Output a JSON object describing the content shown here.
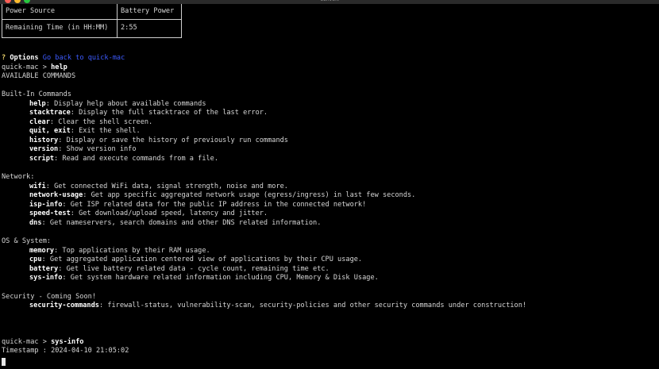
{
  "window": {
    "title": "convert"
  },
  "table": [
    {
      "key": "Power Source",
      "value": "Battery Power"
    },
    {
      "key": "Remaining Time (in HH:MM)",
      "value": "2:55"
    }
  ],
  "options": {
    "marker": "?",
    "label": "Options",
    "link": "Go back to quick-mac"
  },
  "prompt": "quick-mac > ",
  "first_command": "help",
  "available_heading": "AVAILABLE COMMANDS",
  "sections": [
    {
      "title": "Built-In Commands",
      "items": [
        {
          "name": "help",
          "desc": "Display help about available commands"
        },
        {
          "name": "stacktrace",
          "desc": "Display the full stacktrace of the last error."
        },
        {
          "name": "clear",
          "desc": "Clear the shell screen."
        },
        {
          "name": "quit, exit",
          "desc": "Exit the shell."
        },
        {
          "name": "history",
          "desc": "Display or save the history of previously run commands"
        },
        {
          "name": "version",
          "desc": "Show version info"
        },
        {
          "name": "script",
          "desc": "Read and execute commands from a file."
        }
      ]
    },
    {
      "title": "Network:",
      "items": [
        {
          "name": "wifi",
          "desc": "Get connected WiFi data, signal strength, noise and more."
        },
        {
          "name": "network-usage",
          "desc": "Get app specific aggregated network usage (egress/ingress) in last few seconds."
        },
        {
          "name": "isp-info",
          "desc": "Get ISP related data for the public IP address in the connected network!"
        },
        {
          "name": "speed-test",
          "desc": "Get download/upload speed, latency and jitter."
        },
        {
          "name": "dns",
          "desc": "Get nameservers, search domains and other DNS related information."
        }
      ]
    },
    {
      "title": "OS & System:",
      "items": [
        {
          "name": "memory",
          "desc": "Top applications by their RAM usage."
        },
        {
          "name": "cpu",
          "desc": "Get aggregated application centered view of applications by their CPU usage."
        },
        {
          "name": "battery",
          "desc": "Get live battery related data - cycle count, remaining time etc."
        },
        {
          "name": "sys-info",
          "desc": "Get system hardware related information including CPU, Memory & Disk Usage."
        }
      ]
    },
    {
      "title": "Security - Coming Soon!",
      "items": [
        {
          "name": "security-commands",
          "desc": "firewall-status, vulnerability-scan, security-policies and other security commands under construction!"
        }
      ]
    }
  ],
  "last_command": "sys-info",
  "timestamp": "Timestamp : 2024-04-10 21:05:02"
}
